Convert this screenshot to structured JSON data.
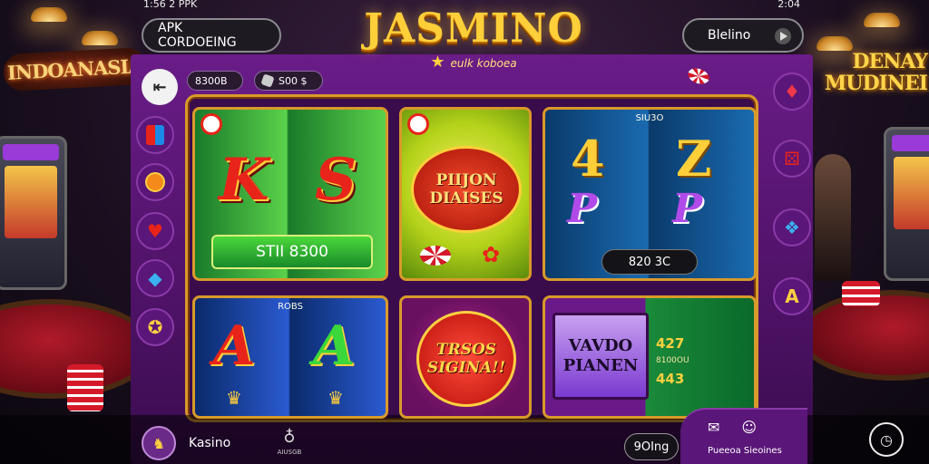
{
  "status": {
    "left": "1:56 2 PPK",
    "right": "2:04"
  },
  "header": {
    "apk_button": "APK CORDOEING",
    "kasino_button": "Blelino"
  },
  "logo": {
    "title": "JASMINO",
    "subtitle": "eulk koboea"
  },
  "background_signs": {
    "left": "INDOANASIA",
    "right_line1": "DENAY",
    "right_line2": "MUDINEI"
  },
  "wallet": {
    "balance": "8300B",
    "coins": "S00 $"
  },
  "side_icons_left": [
    "cards-icon",
    "coin-icon",
    "heart-icon",
    "diamond-icon",
    "star-coin-icon"
  ],
  "side_icons_right": [
    "ruby-icon",
    "dice-icon",
    "gem-icon",
    "a-triangle-icon"
  ],
  "tiles": {
    "t1": {
      "letter1": "K",
      "letter2": "S",
      "bar_text": "STII 8300"
    },
    "t2": {
      "badge_line1": "PIIJON",
      "badge_line2": "DIAISES"
    },
    "t3": {
      "top_label": "SIU3O",
      "big1": "4",
      "big2": "Z",
      "small1": "P",
      "small2": "P",
      "counter": "820 3C"
    },
    "t4": {
      "top_label": "ROBS",
      "letter1": "A",
      "letter2": "A"
    },
    "t5": {
      "badge_line1": "TRSOS",
      "badge_line2": "SIGINA!!"
    },
    "t6": {
      "screen_line1": "VAVDO",
      "screen_line2": "PIANEN",
      "odds1": "427",
      "odds_small": "8100OU",
      "odds2": "443"
    }
  },
  "bottom": {
    "kasino_label": "Kasino",
    "mid_icon_label": "AIUSGB",
    "ding_button": "9OIng",
    "sessions_label": "Pueeoa Sieoines"
  },
  "colors": {
    "panel": "#6a1c88",
    "gold": "#d89a2a",
    "accent": "#ffcf3a"
  }
}
